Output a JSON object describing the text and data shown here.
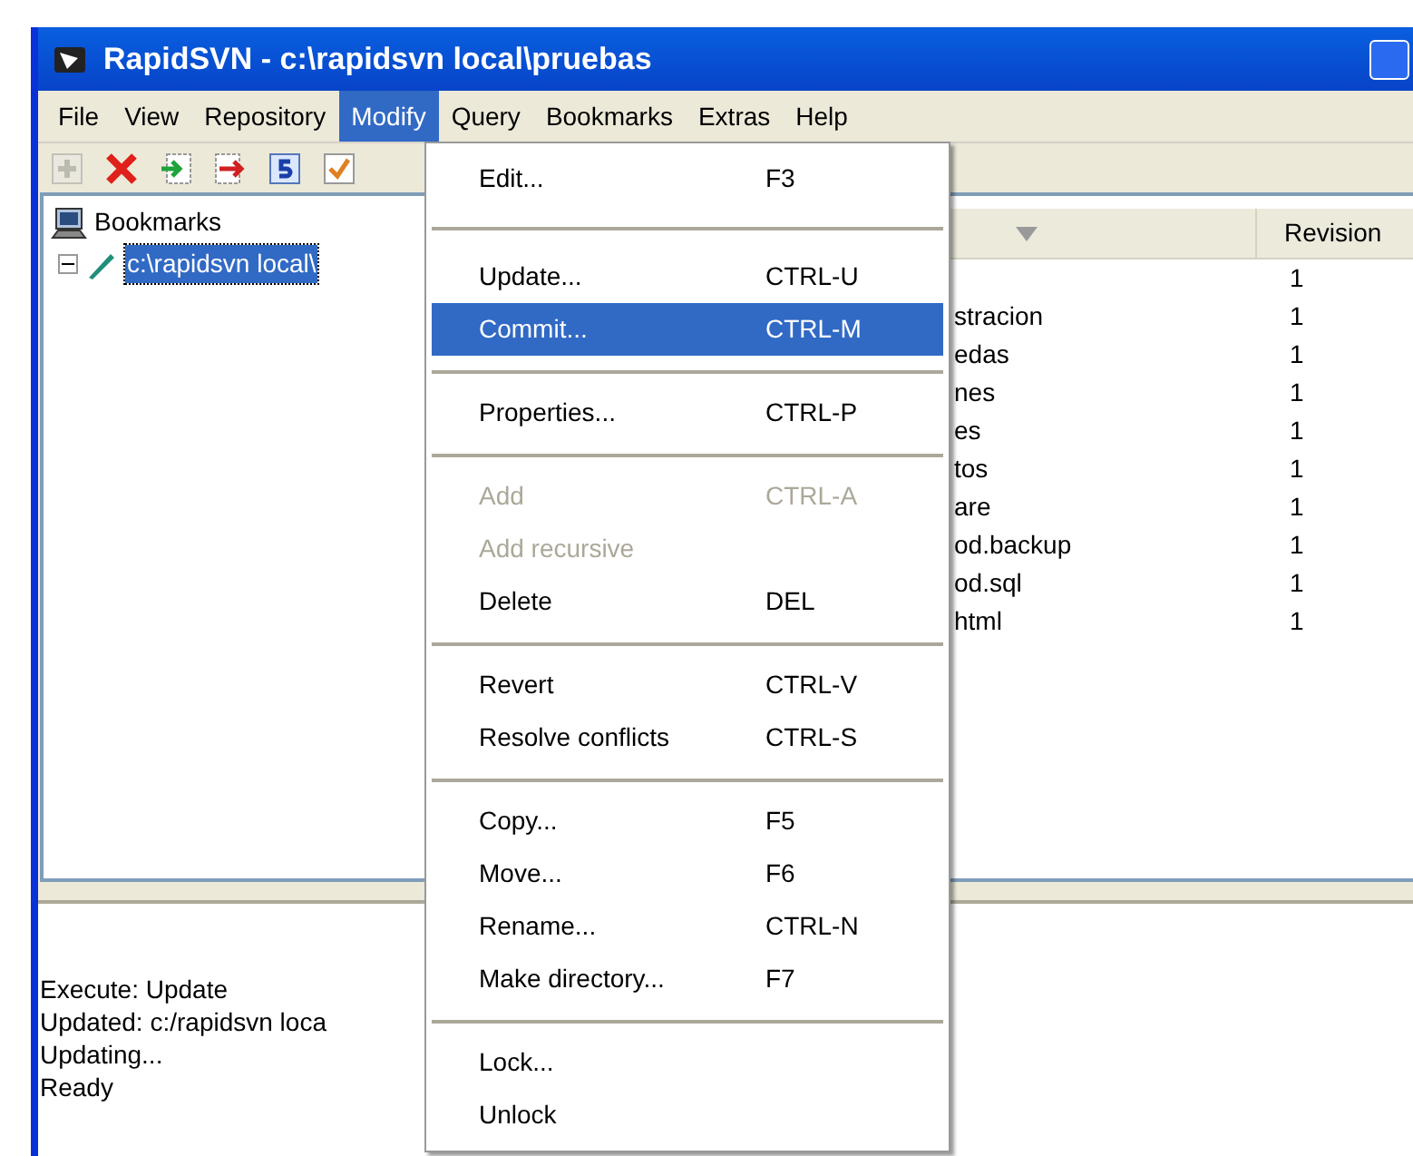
{
  "window": {
    "title": "RapidSVN - c:\\rapidsvn local\\pruebas"
  },
  "menubar": [
    {
      "label": "File",
      "selected": false
    },
    {
      "label": "View",
      "selected": false
    },
    {
      "label": "Repository",
      "selected": false
    },
    {
      "label": "Modify",
      "selected": true
    },
    {
      "label": "Query",
      "selected": false
    },
    {
      "label": "Bookmarks",
      "selected": false
    },
    {
      "label": "Extras",
      "selected": false
    },
    {
      "label": "Help",
      "selected": false
    }
  ],
  "toolbar": [
    {
      "kind": "add",
      "disabled": true
    },
    {
      "kind": "delete",
      "disabled": false
    },
    {
      "kind": "import",
      "disabled": false
    },
    {
      "kind": "export",
      "disabled": false
    },
    {
      "kind": "refresh",
      "disabled": false
    },
    {
      "kind": "check",
      "disabled": false
    }
  ],
  "tree": {
    "label": "Bookmarks",
    "expanded": true,
    "children": [
      {
        "label": "c:\\rapidsvn local\\",
        "selected": true
      }
    ]
  },
  "table": {
    "columns": [
      {
        "sorted": true
      },
      {
        "label": "Revision"
      }
    ],
    "rows": [
      {
        "revision": "1"
      },
      {
        "name": "stracion",
        "revision": "1"
      },
      {
        "name": "edas",
        "revision": "1"
      },
      {
        "name": "nes",
        "revision": "1"
      },
      {
        "name": "es",
        "revision": "1"
      },
      {
        "name": "tos",
        "revision": "1"
      },
      {
        "name": "are",
        "revision": "1"
      },
      {
        "name": "od.backup",
        "revision": "1"
      },
      {
        "name": "od.sql",
        "revision": "1"
      },
      {
        "name": "html",
        "revision": "1"
      }
    ]
  },
  "log": [
    "Execute: Update",
    "Updated: c:/rapidsvn loca",
    "Updating...",
    "Ready"
  ],
  "menu": {
    "items": [
      {
        "kind": "item",
        "label": "Edit...",
        "shortcut": "F3",
        "disabled": false,
        "selected": false
      },
      {
        "kind": "separator"
      },
      {
        "kind": "item",
        "label": "Update...",
        "shortcut": "CTRL-U",
        "disabled": false,
        "selected": false
      },
      {
        "kind": "item",
        "label": "Commit...",
        "shortcut": "CTRL-M",
        "disabled": false,
        "selected": true
      },
      {
        "kind": "separator"
      },
      {
        "kind": "item",
        "label": "Properties...",
        "shortcut": "CTRL-P",
        "disabled": false,
        "selected": false
      },
      {
        "kind": "separator"
      },
      {
        "kind": "item",
        "label": "Add",
        "shortcut": "CTRL-A",
        "disabled": true,
        "selected": false
      },
      {
        "kind": "item",
        "label": "Add recursive",
        "disabled": true,
        "selected": false
      },
      {
        "kind": "item",
        "label": "Delete",
        "shortcut": "DEL",
        "disabled": false,
        "selected": false
      },
      {
        "kind": "separator"
      },
      {
        "kind": "item",
        "label": "Revert",
        "shortcut": "CTRL-V",
        "disabled": false,
        "selected": false
      },
      {
        "kind": "item",
        "label": "Resolve conflicts",
        "shortcut": "CTRL-S",
        "disabled": false,
        "selected": false
      },
      {
        "kind": "separator"
      },
      {
        "kind": "item",
        "label": "Copy...",
        "shortcut": "F5",
        "disabled": false,
        "selected": false
      },
      {
        "kind": "item",
        "label": "Move...",
        "shortcut": "F6",
        "disabled": false,
        "selected": false
      },
      {
        "kind": "item",
        "label": "Rename...",
        "shortcut": "CTRL-N",
        "disabled": false,
        "selected": false
      },
      {
        "kind": "item",
        "label": "Make directory...",
        "shortcut": "F7",
        "disabled": false,
        "selected": false
      },
      {
        "kind": "separator"
      },
      {
        "kind": "item",
        "label": "Lock...",
        "disabled": false,
        "selected": false
      },
      {
        "kind": "item",
        "label": "Unlock",
        "disabled": false,
        "selected": false
      }
    ]
  }
}
